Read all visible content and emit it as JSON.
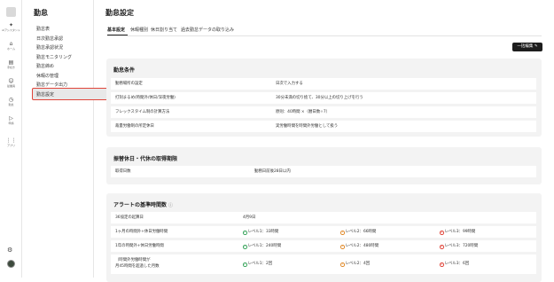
{
  "rail": {
    "items": [
      {
        "icon": "sparkle-icon",
        "glyph": "✦",
        "label": "AIアシスタント"
      },
      {
        "icon": "home-icon",
        "glyph": "⌂",
        "label": "ホーム"
      },
      {
        "icon": "clipboard-icon",
        "glyph": "▤",
        "label": "手続き"
      },
      {
        "icon": "people-icon",
        "glyph": "☺",
        "label": "従業員"
      },
      {
        "icon": "clock-icon",
        "glyph": "◷",
        "label": "勤怠"
      },
      {
        "icon": "play-icon",
        "glyph": "▷",
        "label": "申請"
      },
      {
        "icon": "apps-icon",
        "glyph": "⋮⋮",
        "label": "アプリ"
      }
    ],
    "gear_glyph": "⚙"
  },
  "subnav": {
    "title": "勤怠",
    "items": [
      "勤怠表",
      "日次勤怠承認",
      "勤怠承認状況",
      "勤怠モニタリング",
      "勤怠締め",
      "休暇の管理",
      "勤怠データ出力",
      "勤怠設定"
    ]
  },
  "main": {
    "title": "勤怠設定",
    "tabs": [
      "基本設定",
      "休暇種別",
      "休日割り当て",
      "過去勤怠データの取り込み"
    ],
    "bulk_button": "一括編集"
  },
  "section1": {
    "title": "勤怠条件",
    "rows": [
      {
        "label": "勤務場所の設定",
        "value": "日次で入力する"
      },
      {
        "label": "打刻まるめ(時間外/休日/深夜労働)",
        "value": "30分未満の切り捨て、30分以上の切り上げを行う"
      },
      {
        "label": "フレックスタイム制の計算方法",
        "value": "原則：40時間 ×（暦日数÷7）"
      },
      {
        "label": "裁量労働制の所定休日",
        "value": "実労働時間を時間外労働として扱う"
      }
    ]
  },
  "section2": {
    "title": "振替休日・代休の取得期限",
    "rows": [
      {
        "label": "取得日数",
        "value": "勤務日前後28日以内"
      }
    ]
  },
  "section3": {
    "title": "アラートの基準時間数",
    "help_glyph": "ⓘ",
    "start": {
      "label": "36協定の起算日",
      "value": "4月9日"
    },
    "rows": [
      {
        "label": "1ヶ月の時間外+休日労働時間",
        "l1": "レベル1：33時間",
        "l2": "レベル2：66時間",
        "l3": "レベル3：99時間"
      },
      {
        "label": "1年の時間外+休日労働時間",
        "l1": "レベル1：240時間",
        "l2": "レベル2：480時間",
        "l3": "レベル3：720時間"
      },
      {
        "label1": "（時間外労働時間が",
        "label2": "月45時間を超過した月数",
        "l1": "レベル1：2回",
        "l2": "レベル2：4回",
        "l3": "レベル3：6回"
      }
    ],
    "glyph_ok": "✓",
    "glyph_warn": "!",
    "glyph_ng": "×"
  }
}
